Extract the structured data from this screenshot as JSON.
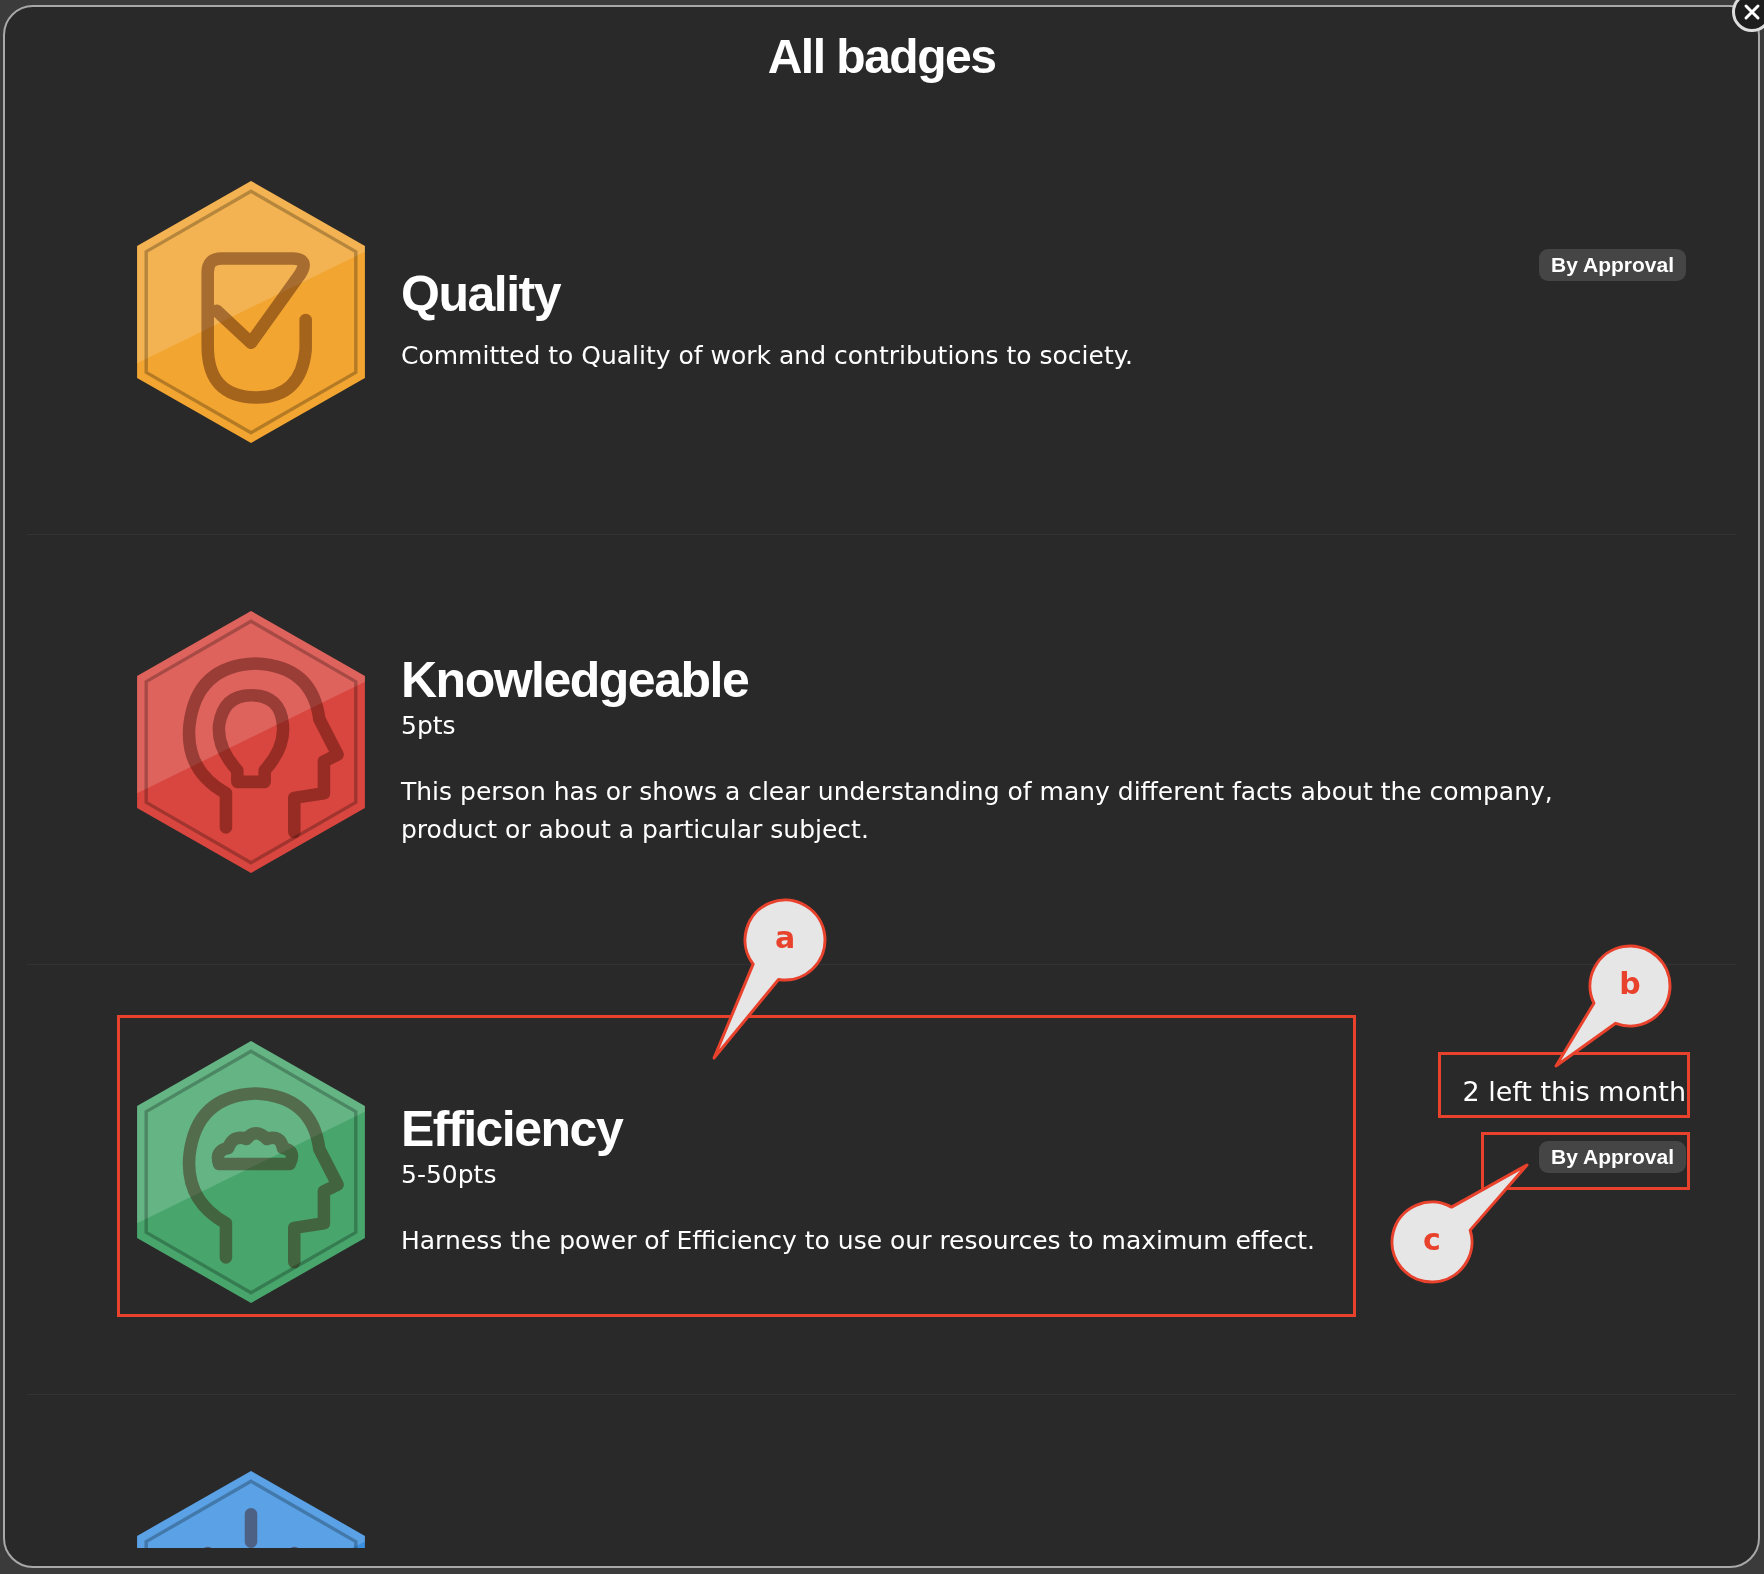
{
  "dialog": {
    "title": "All badges"
  },
  "badges": [
    {
      "name": "Quality",
      "description": "Committed to Quality of work and contributions to society.",
      "approval": "By Approval",
      "color": "#f2a531"
    },
    {
      "name": "Knowledgeable",
      "points": "5pts",
      "description": "This person has or shows a clear understanding of many different facts about the company, product or about a particular subject.",
      "color": "#d9463f"
    },
    {
      "name": "Efficiency",
      "points": "5-50pts",
      "description": "Harness the power of Efficiency to use our resources to maximum effect.",
      "remaining": "2 left this month",
      "approval": "By Approval",
      "color": "#48a66d"
    },
    {
      "color": "#3b8fe0"
    }
  ],
  "annotations": [
    {
      "label": "a"
    },
    {
      "label": "b"
    },
    {
      "label": "c"
    }
  ]
}
